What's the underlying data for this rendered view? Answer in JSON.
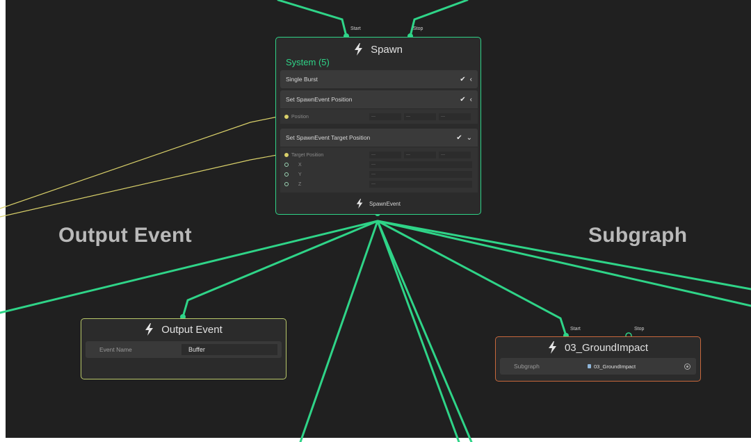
{
  "sections": {
    "left_title": "Output Event",
    "right_title": "Subgraph"
  },
  "spawn_node": {
    "title": "Spawn",
    "port_start": "Start",
    "port_stop": "Stop",
    "system_label": "System (5)",
    "blocks": [
      {
        "title": "Single Burst"
      },
      {
        "title": "Set SpawnEvent Position",
        "prop": "Position",
        "fields": [
          "—",
          "—",
          "—"
        ]
      },
      {
        "title": "Set SpawnEvent Target Position",
        "prop": "Target Position",
        "fields": [
          "—",
          "—",
          "—"
        ],
        "sub": [
          {
            "label": "X",
            "value": "—"
          },
          {
            "label": "Y",
            "value": "—"
          },
          {
            "label": "Z",
            "value": "—"
          }
        ]
      }
    ],
    "output_port": "SpawnEvent"
  },
  "output_event_node": {
    "title": "Output Event",
    "field_label": "Event Name",
    "field_value": "Buffer"
  },
  "subgraph_node": {
    "title": "03_GroundImpact",
    "port_start": "Start",
    "port_stop": "Stop",
    "field_label": "Subgraph",
    "field_value": "03_GroundImpact"
  },
  "colors": {
    "wire_green": "#2fd488",
    "wire_yellow": "#d9d06a",
    "background": "#202020",
    "node_border_green": "#2fd488",
    "node_border_yellow": "#b9c86a",
    "node_border_orange": "#c8683c"
  },
  "icons": [
    "lightning-bolt-icon",
    "checkmark-icon",
    "chevron-left-icon",
    "chevron-down-icon",
    "settings-icon"
  ]
}
